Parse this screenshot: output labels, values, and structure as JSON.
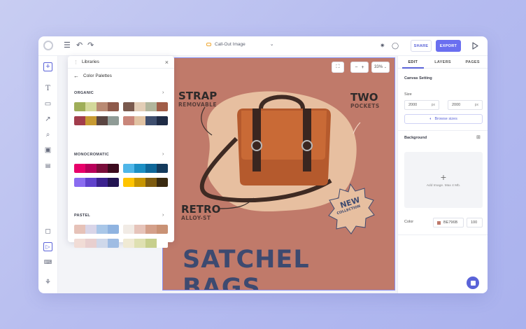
{
  "app": {
    "doc_title": "Call-Out Image",
    "share_label": "SHARE",
    "export_label": "EXPORT"
  },
  "libraries": {
    "title": "Libraries",
    "subtitle": "Color Palettes",
    "sections": [
      {
        "name": "ORGANIC",
        "palettes": [
          [
            "#9fae59",
            "#d3d89a",
            "#b98a73",
            "#8e5a4b"
          ],
          [
            "#7a5a4e",
            "#e2cdb6",
            "#b1b59c",
            "#a15d48"
          ],
          [
            "#a23d4c",
            "#c79a32",
            "#5a4541",
            "#8f9b96"
          ],
          [
            "#c9867a",
            "#e1c3a3",
            "#3e4e6e",
            "#1f2b45"
          ]
        ]
      },
      {
        "name": "MONOCROMATIC",
        "palettes": [
          [
            "#e8006a",
            "#b8005a",
            "#7a0d3a",
            "#3c0b1e"
          ],
          [
            "#4fb6e8",
            "#1c8fc4",
            "#0f6799",
            "#143a5c"
          ],
          [
            "#8a6cf0",
            "#6042cc",
            "#3b228f",
            "#221452"
          ],
          [
            "#ffc400",
            "#c79500",
            "#7d5b10",
            "#3a2a10"
          ]
        ]
      },
      {
        "name": "PASTEL",
        "palettes": [
          [
            "#e6c2b8",
            "#d9d5e8",
            "#a9c7e8",
            "#8fb3e0"
          ],
          [
            "#f1ebe5",
            "#e6c4ba",
            "#d4a08a",
            "#c99275"
          ],
          [
            "#f1dcd6",
            "#e8cfcf",
            "#cfd8ea",
            "#9fbce3"
          ],
          [
            "#f0ead4",
            "#dfe0b2",
            "#c7cf8d",
            "#ffffff"
          ]
        ]
      }
    ]
  },
  "zoom": {
    "value": "33%"
  },
  "artboard": {
    "strap": "STRAP",
    "removable": "REMOVABLE",
    "two": "TWO",
    "pockets": "POCKETS",
    "retro": "RETRO",
    "alloy": "ALLOY-ST",
    "new": "NEW",
    "collection": "COLLECTION",
    "headline": "SATCHEL BAGS"
  },
  "rightpanel": {
    "tabs": [
      "EDIT",
      "LAYERS",
      "PAGES"
    ],
    "canvas_setting": "Canvas Setting",
    "size_label": "Size",
    "width": "2000",
    "height": "2000",
    "unit": "px",
    "browse_sizes": "Browse sizes",
    "background_label": "Background",
    "add_image": "Add Image. Max 4 Mb.",
    "color_label": "Color",
    "color_hex": "BE796B",
    "opacity": "100"
  },
  "colors": {
    "accent": "#6a6ff0",
    "artboard_bg": "#c07a6a",
    "headline": "#3d4a70"
  }
}
